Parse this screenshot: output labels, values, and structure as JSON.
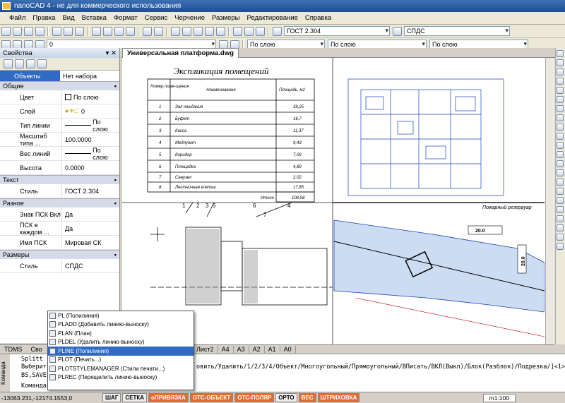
{
  "window": {
    "title": "nanoCAD 4 - не для коммерческого использования"
  },
  "menu": [
    "Файл",
    "Правка",
    "Вид",
    "Вставка",
    "Формат",
    "Сервис",
    "Черчение",
    "Размеры",
    "Редактирование",
    "Справка"
  ],
  "toolbar": {
    "text_style": "ГОСТ 2.304",
    "dim_style": "СПДС",
    "layer": "0",
    "color": "По слою",
    "linetype": "По слою",
    "lineweight": "По слою"
  },
  "properties": {
    "title": "Свойства",
    "selection_key": "Объекты",
    "selection_value": "Нет набора",
    "groups": [
      {
        "name": "Общие",
        "rows": [
          {
            "k": "Цвет",
            "v": "По слою"
          },
          {
            "k": "Слой",
            "v": "0"
          },
          {
            "k": "Тип линии",
            "v": "По слою"
          },
          {
            "k": "Масштаб типа ...",
            "v": "100.0000"
          },
          {
            "k": "Вес линий",
            "v": "По слою"
          },
          {
            "k": "Высота",
            "v": "0.0000"
          }
        ]
      },
      {
        "name": "Текст",
        "rows": [
          {
            "k": "Стиль",
            "v": "ГОСТ 2.304"
          }
        ]
      },
      {
        "name": "Разное",
        "rows": [
          {
            "k": "Знак ПСК Вкл",
            "v": "Да"
          },
          {
            "k": "ПСК в каждом ...",
            "v": "Да"
          },
          {
            "k": "Имя ПСК",
            "v": "Мировая СК"
          }
        ]
      },
      {
        "name": "Размеры",
        "rows": [
          {
            "k": "Стиль",
            "v": "СПДС"
          }
        ]
      }
    ]
  },
  "document": {
    "tab": "Универсальная платформа.dwg"
  },
  "drawing": {
    "table_title": "Экспликация помещений",
    "table_headers": [
      "Номер поме-щения",
      "Наименование",
      "Площадь, м2"
    ],
    "table_rows": [
      [
        "1",
        "Зал ожидания",
        "39,25"
      ],
      [
        "2",
        "Буфет",
        "16,7"
      ],
      [
        "3",
        "Касса",
        "11,37"
      ],
      [
        "4",
        "Медпункт",
        "9,43"
      ],
      [
        "5",
        "Коридор",
        "7,09"
      ],
      [
        "6",
        "Площадка",
        "4,89"
      ],
      [
        "7",
        "Санузел",
        "2,02"
      ],
      [
        "8",
        "Лестничная клетка",
        "17,85"
      ]
    ],
    "table_total_label": "Итого",
    "table_total": "108,58",
    "map_label": "Пожарный резервуар",
    "map_values": [
      "20.0",
      "20.0"
    ],
    "detail_numbers": [
      "1",
      "2",
      "3",
      "5",
      "6",
      "7",
      "4"
    ]
  },
  "layout_tabs": [
    "Лист2",
    "A4",
    "A3",
    "A2",
    "A1",
    "A0"
  ],
  "left_tabs": [
    "TDMS",
    "Сво"
  ],
  "command": {
    "vlabel": "Команда",
    "lines": [
      "Splitt",
      "Выберит",
      "BS,SAVE",
      "Команда: PLINE"
    ],
    "prompt": "овить/Удалить/1/2/3/4/Объект/Многоугольный/Прямоугольный/ВПисать/ВКЛ(Выкл)/Блок(Разблок)/Подрезка/]<1>"
  },
  "autocomplete": [
    "PL (Полилиния)",
    "PLADD (Добавить линию-выноску)",
    "PLAN (План)",
    "PLDEL (Удалить линию-выноску)",
    "PLINE (Полилиния)",
    "PLOT (Печать...)",
    "PLOTSTYLEMANAGER (Стили печати...)",
    "PLREC (Перещелить линию-выноску)"
  ],
  "status": {
    "coords": "-13063.231,-12174.1553,0",
    "buttons": [
      {
        "label": "ШАГ",
        "on": true
      },
      {
        "label": "СЕТКА",
        "on": true
      },
      {
        "label": "оПРИВЯЗКА",
        "on": false
      },
      {
        "label": "ОТС-ОБЪЕКТ",
        "on": false
      },
      {
        "label": "ОТС-ПОЛЯР",
        "on": false
      },
      {
        "label": "ОРТО",
        "on": true
      },
      {
        "label": "ВЕС",
        "on": false
      },
      {
        "label": "ШТРИХОВКА",
        "on": false
      }
    ],
    "scale": "m1:100"
  }
}
